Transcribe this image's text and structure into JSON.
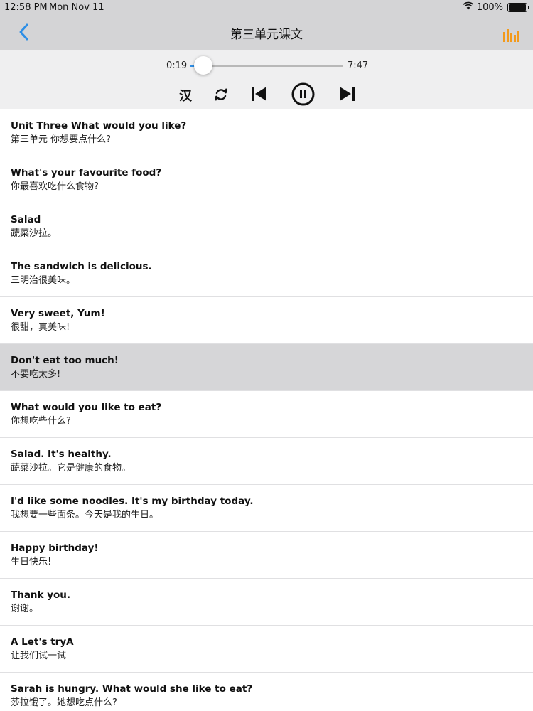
{
  "status_bar": {
    "time": "12:58 PM",
    "date": "Mon Nov 11",
    "battery": "100%"
  },
  "nav": {
    "title": "第三单元课文",
    "accent_color": "#2e8fe6",
    "eq_color": "#f39a1c"
  },
  "player": {
    "current_time": "0:19",
    "total_time": "7:47",
    "progress": 0.04,
    "translate_toggle": "汉"
  },
  "sentences": [
    {
      "en": "Unit Three What would you like?",
      "zh": "第三单元 你想要点什么?"
    },
    {
      "en": "What's your favourite food?",
      "zh": "你最喜欢吃什么食物?"
    },
    {
      "en": "Salad",
      "zh": "蔬菜沙拉。"
    },
    {
      "en": "The sandwich is delicious.",
      "zh": "三明治很美味。"
    },
    {
      "en": "Very sweet, Yum!",
      "zh": "很甜，真美味!"
    },
    {
      "en": "Don't eat too much!",
      "zh": "不要吃太多!"
    },
    {
      "en": "What would you like to eat?",
      "zh": "你想吃些什么?"
    },
    {
      "en": "Salad. It's healthy.",
      "zh": "蔬菜沙拉。它是健康的食物。"
    },
    {
      "en": "I'd like some noodles. It's my birthday today.",
      "zh": "我想要一些面条。今天是我的生日。"
    },
    {
      "en": "Happy birthday!",
      "zh": "生日快乐!"
    },
    {
      "en": "Thank you.",
      "zh": "谢谢。"
    },
    {
      "en": "A Let's tryA",
      "zh": "让我们试一试"
    },
    {
      "en": "Sarah is hungry. What would she like to eat?",
      "zh": "莎拉饿了。她想吃点什么?"
    }
  ],
  "active_index": 5
}
